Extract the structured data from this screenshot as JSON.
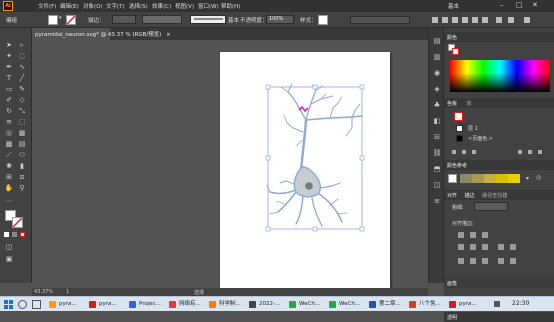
{
  "menubar": {
    "logo": "Ai",
    "items": [
      "文件(F)",
      "编辑(E)",
      "对象(O)",
      "文字(T)",
      "选择(S)",
      "效果(C)",
      "视图(V)",
      "窗口(W)",
      "帮助(H)"
    ],
    "workspace": "基本",
    "right_label": "变换"
  },
  "controlbar": {
    "selection_label": "编组",
    "stroke_label": "描边：",
    "stroke_profile": "基本",
    "opacity_label": "不透明度：",
    "opacity_value": "100%",
    "style_label": "样式："
  },
  "document": {
    "tab_label": "pyramidal_neuron.svg* @ 43.37 % (RGB/预览)"
  },
  "status": {
    "zoom": "43.37%",
    "page": "1",
    "tool_name": "选择"
  },
  "panels": {
    "color": {
      "title": "颜色"
    },
    "swatches": {
      "tabs": [
        "色板",
        "库"
      ]
    },
    "layers": {
      "row1": "层 1",
      "row2": "<页面色.>"
    },
    "color_guide": {
      "title": "颜色参考"
    },
    "align": {
      "tabs": [
        "对齐",
        "描边",
        "路径查找器"
      ],
      "row_label1": "粗细:",
      "row_label2": "对齐描边:"
    },
    "transparency": {
      "title": "透明"
    },
    "brushes": {
      "title": "画笔"
    }
  },
  "colors": {
    "neuron_stroke": "#8ea9d3",
    "neuron_fill": "#c7cdd3",
    "nucleus": "#6e7b82",
    "highlight": "#d02ac8",
    "selection": "#7c9ce0"
  },
  "taskbar": {
    "items": [
      {
        "label": "pyra...",
        "color": "#ff9a00"
      },
      {
        "label": "pyra...",
        "color": "#cc2222"
      },
      {
        "label": "Projec...",
        "color": "#3366cc"
      },
      {
        "label": "网络有...",
        "color": "#e03b3b"
      },
      {
        "label": "科学制...",
        "color": "#ff7a00"
      },
      {
        "label": "2022-...",
        "color": "#444444"
      },
      {
        "label": "WeCh...",
        "color": "#22aa44"
      },
      {
        "label": "WeCh...",
        "color": "#22aa44"
      },
      {
        "label": "第二章...",
        "color": "#2255aa"
      },
      {
        "label": "八个免...",
        "color": "#d04020"
      },
      {
        "label": "pyra...",
        "color": "#cc2222"
      }
    ],
    "time": "22:30"
  }
}
